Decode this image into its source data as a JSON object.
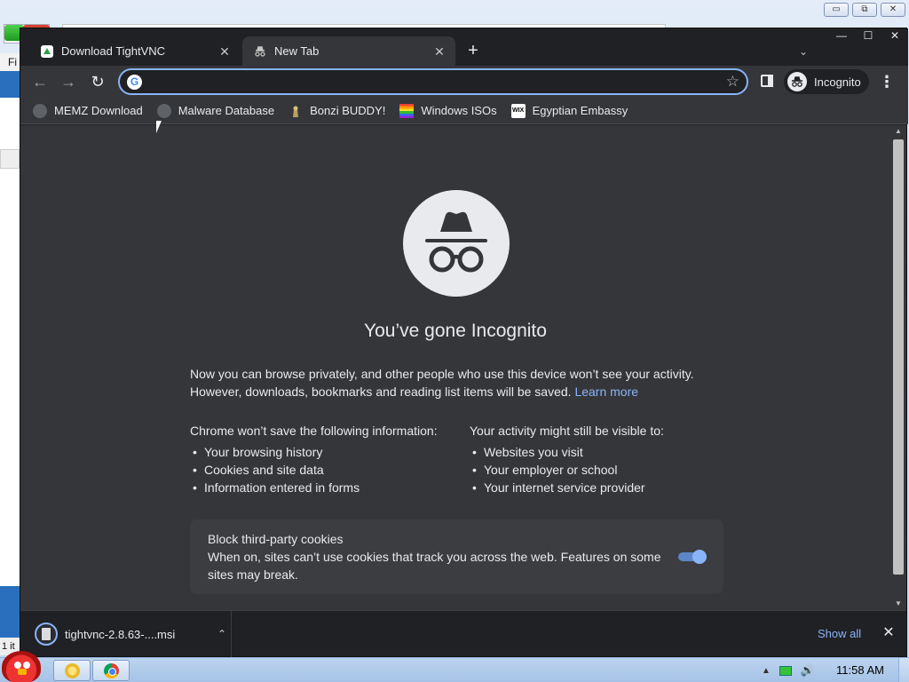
{
  "background_window": {
    "menu_label": "Fi",
    "status_text": "1 it",
    "buttons": [
      "▭",
      "⧉",
      "✕"
    ]
  },
  "chrome": {
    "tabs": [
      {
        "title": "Download TightVNC",
        "close": "✕",
        "icon": "tightvnc-icon",
        "active": false
      },
      {
        "title": "New Tab",
        "close": "✕",
        "icon": "incognito-icon",
        "active": true
      }
    ],
    "new_tab_symbol": "+",
    "tab_search_symbol": "⌄",
    "window_controls": {
      "minimize": "—",
      "maximize": "☐",
      "close": "✕"
    },
    "toolbar": {
      "back": "←",
      "forward": "→",
      "reload": "↻",
      "omnibox_value": "",
      "omnibox_placeholder": "",
      "search_engine_icon": "G",
      "star": "☆",
      "profile_label": "Incognito",
      "menu": "⋮"
    },
    "bookmarks": [
      {
        "label": "MEMZ Download",
        "icon": "globe-icon"
      },
      {
        "label": "Malware Database",
        "icon": "globe-icon"
      },
      {
        "label": "Bonzi BUDDY!",
        "icon": "bonzi-icon"
      },
      {
        "label": "Windows ISOs",
        "icon": "rainbow-icon"
      },
      {
        "label": "Egyptian Embassy",
        "icon": "wix-icon"
      }
    ],
    "incognito_page": {
      "heading": "You’ve gone Incognito",
      "intro_line1": "Now you can browse privately, and other people who use this device won’t see your activity.",
      "intro_line2": "However, downloads, bookmarks and reading list items will be saved.",
      "learn_more": "Learn more",
      "left_column": {
        "title": "Chrome won’t save the following information:",
        "items": [
          "Your browsing history",
          "Cookies and site data",
          "Information entered in forms"
        ]
      },
      "right_column": {
        "title": "Your activity might still be visible to:",
        "items": [
          "Websites you visit",
          "Your employer or school",
          "Your internet service provider"
        ]
      },
      "cookie_card": {
        "title": "Block third-party cookies",
        "description": "When on, sites can’t use cookies that track you across the web. Features on some sites may break.",
        "toggle_on": true
      }
    },
    "download_bar": {
      "filename": "tightvnc-2.8.63-....msi",
      "caret": "⌃",
      "show_all": "Show all",
      "close": "✕"
    }
  },
  "taskbar": {
    "clock": "11:58 AM",
    "tray_arrow": "▲",
    "volume": "🔊"
  },
  "colors": {
    "chrome_dark": "#202124",
    "chrome_surface": "#35363a",
    "link_blue": "#8ab4f8",
    "text": "#e8eaed"
  }
}
